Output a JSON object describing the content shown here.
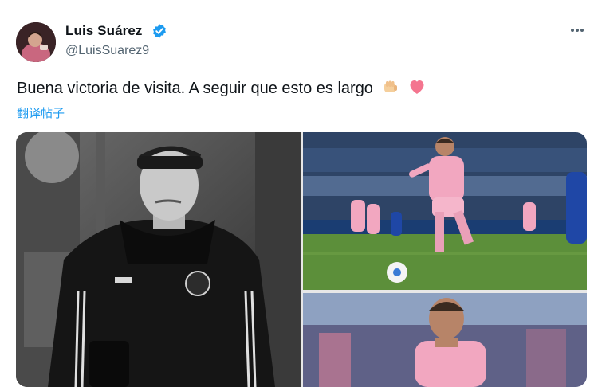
{
  "author": {
    "display_name": "Luis Suárez",
    "handle": "@LuisSuarez9",
    "verified": true
  },
  "tweet": {
    "text": "Buena victoria de visita. A seguir que esto es largo",
    "emojis": [
      "oncoming-fist",
      "pink-heart"
    ],
    "translate_label": "翻译帖子"
  },
  "media": {
    "count": 3,
    "photos": [
      {
        "description": "black-and-white"
      },
      {
        "description": "match action"
      },
      {
        "description": "crowd"
      }
    ]
  },
  "colors": {
    "accent": "#1d9bf0",
    "kit_pink": "#f2a7c0",
    "pitch_green": "#5c8f3a",
    "heart": "#f4758f"
  },
  "icons": [
    "verified-badge-icon",
    "more-options-icon"
  ]
}
